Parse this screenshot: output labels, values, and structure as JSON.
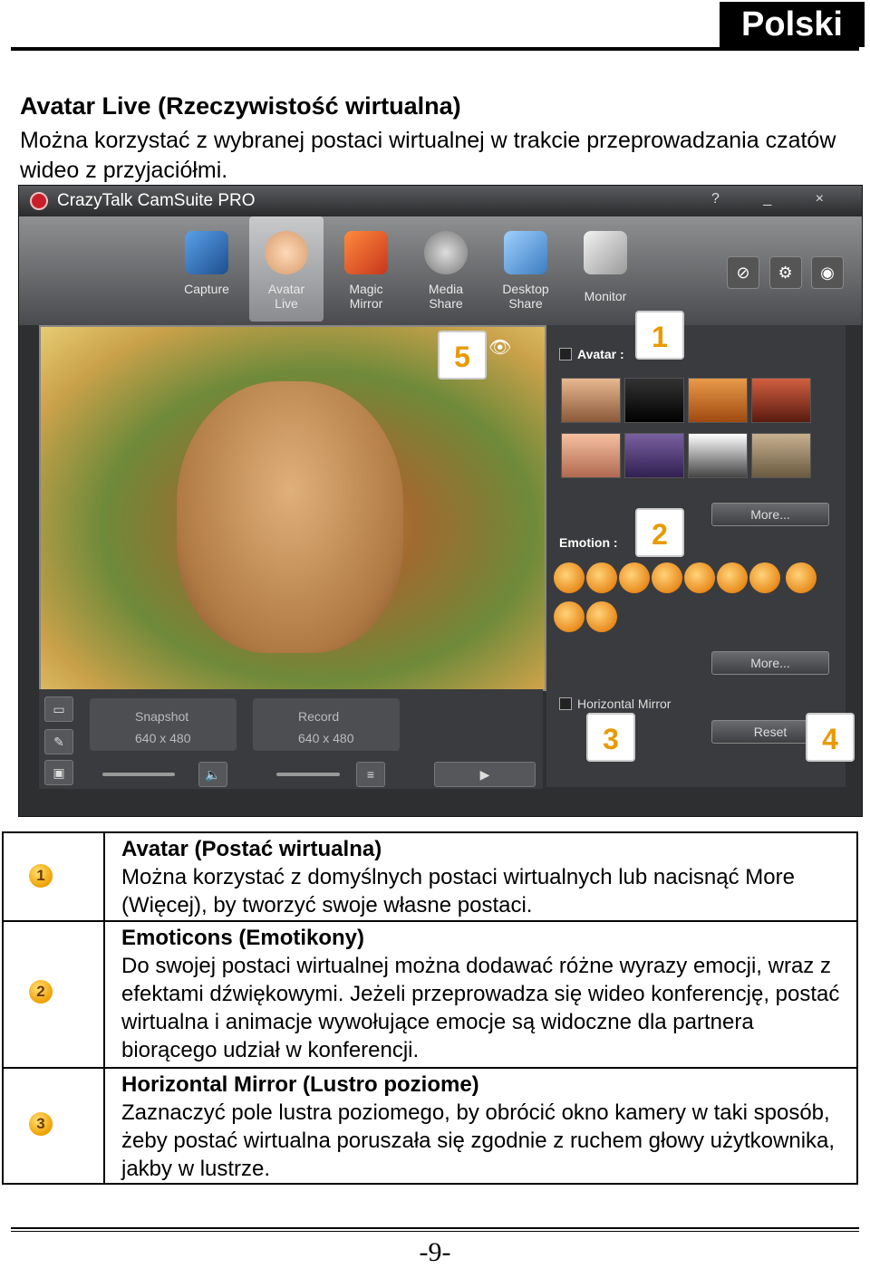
{
  "language_tag": "Polski",
  "section": {
    "title": "Avatar Live (Rzeczywistość wirtualna)",
    "intro": "Można korzystać z wybranej postaci wirtualnej w trakcie przeprowadzania czatów wideo z przyjaciółmi."
  },
  "screenshot": {
    "app_title": "CrazyTalk CamSuite PRO",
    "window_controls": "? _ ×",
    "nav": [
      {
        "label": "Capture",
        "icon": "webcam-icon"
      },
      {
        "label": "Avatar Live",
        "icon": "baby-face-icon"
      },
      {
        "label": "Magic Mirror",
        "icon": "mask-icon"
      },
      {
        "label": "Media Share",
        "icon": "film-reel-icon"
      },
      {
        "label": "Desktop Share",
        "icon": "monitors-icon"
      },
      {
        "label": "Monitor",
        "icon": "security-camera-icon"
      }
    ],
    "avatar_label": "Avatar :",
    "emotion_label": "Emotion :",
    "more_label": "More...",
    "horizontal_mirror_label": "Horizontal Mirror",
    "reset_label": "Reset",
    "snapshot_label": "Snapshot",
    "snapshot_res": "640 x 480",
    "record_label": "Record",
    "record_res": "640 x 480",
    "callouts": [
      "1",
      "2",
      "3",
      "4",
      "5"
    ]
  },
  "rows": [
    {
      "num": "1",
      "title": "Avatar (Postać wirtualna)",
      "body": "Można korzystać z domyślnych postaci wirtualnych lub nacisnąć More (Więcej), by tworzyć swoje własne postaci."
    },
    {
      "num": "2",
      "title": "Emoticons (Emotikony)",
      "body": "Do swojej postaci wirtualnej można dodawać różne wyrazy emocji, wraz z efektami dźwiękowymi. Jeżeli przeprowadza się wideo konferencję, postać wirtualna i animacje wywołujące emocje są widoczne dla partnera biorącego udział w konferencji."
    },
    {
      "num": "3",
      "title": "Horizontal Mirror (Lustro poziome)",
      "body": "Zaznaczyć pole lustra poziomego, by obrócić okno kamery w taki sposób, żeby postać wirtualna poruszała się zgodnie z ruchem głowy użytkownika, jakby w lustrze."
    }
  ],
  "page_number": "-9-"
}
